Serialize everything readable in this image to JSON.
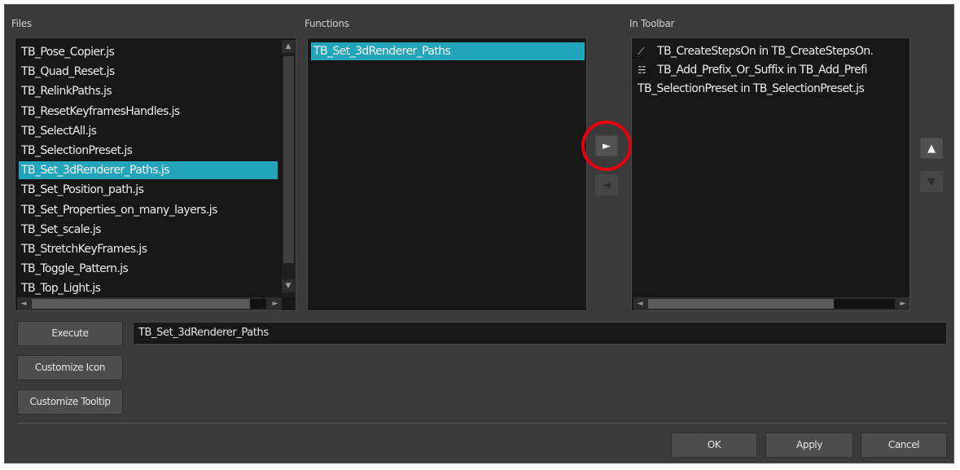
{
  "labels": {
    "files": "Files",
    "functions": "Functions",
    "in_toolbar": "In Toolbar"
  },
  "files": [
    "TB_Pose_Copier.js",
    "TB_Quad_Reset.js",
    "TB_RelinkPaths.js",
    "TB_ResetKeyframesHandles.js",
    "TB_SelectAll.js",
    "TB_SelectionPreset.js",
    "TB_Set_3dRenderer_Paths.js",
    "TB_Set_Position_path.js",
    "TB_Set_Properties_on_many_layers.js",
    "TB_Set_scale.js",
    "TB_StretchKeyFrames.js",
    "TB_Toggle_Pattern.js",
    "TB_Top_Light.js"
  ],
  "files_selected": "TB_Set_3dRenderer_Paths.js",
  "functions": [
    "TB_Set_3dRenderer_Paths"
  ],
  "toolbar": [
    {
      "label": "TB_CreateStepsOn in TB_CreateStepsOn.",
      "icon": "steps-icon",
      "glyph": "⟋"
    },
    {
      "label": "TB_Add_Prefix_Or_Suffix in TB_Add_Prefi",
      "icon": "prefix-suffix-icon",
      "glyph": "☵"
    },
    {
      "label": "TB_SelectionPreset in TB_SelectionPreset.js",
      "icon": "",
      "glyph": ""
    }
  ],
  "arrows": {
    "add": "►",
    "remove": "◄",
    "up": "▲",
    "down": "▼"
  },
  "scroll_glyphs": {
    "up": "▲",
    "down": "▼",
    "left": "◄",
    "right": "►"
  },
  "buttons": {
    "execute": "Execute",
    "customize_icon": "Customize Icon",
    "customize_tooltip": "Customize Tooltip",
    "ok": "OK",
    "apply": "Apply",
    "cancel": "Cancel"
  },
  "function_field_value": "TB_Set_3dRenderer_Paths",
  "colors": {
    "selection": "#22a5bb",
    "highlight_circle": "#e8000d",
    "background": "#3a3a3a",
    "list_bg": "#171717"
  }
}
